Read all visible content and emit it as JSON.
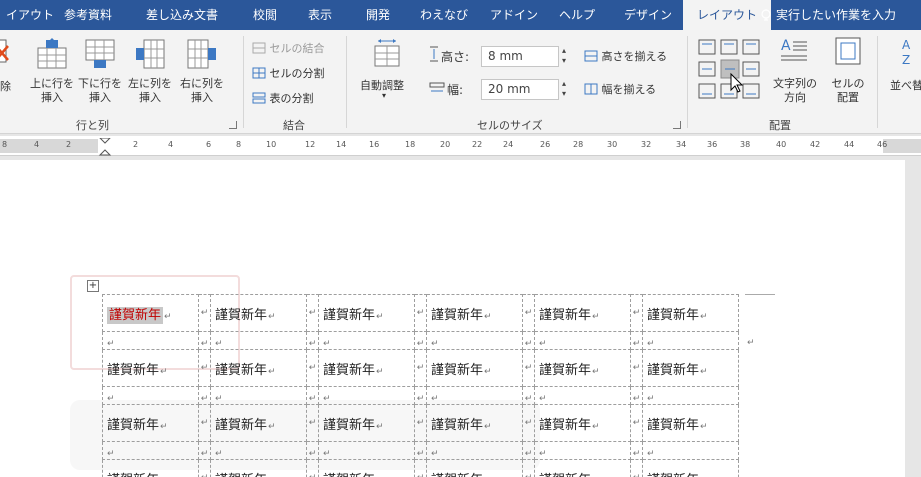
{
  "tabs": [
    {
      "label": "イアウト",
      "active": false
    },
    {
      "label": "参考資料",
      "active": false
    },
    {
      "label": "差し込み文書",
      "active": false
    },
    {
      "label": "校閲",
      "active": false
    },
    {
      "label": "表示",
      "active": false
    },
    {
      "label": "開発",
      "active": false
    },
    {
      "label": "わえなび",
      "active": false
    },
    {
      "label": "アドイン",
      "active": false
    },
    {
      "label": "ヘルプ",
      "active": false
    },
    {
      "label": "デザイン",
      "active": false
    },
    {
      "label": "レイアウト",
      "active": true
    }
  ],
  "tell_me": "実行したい作業を入力",
  "rows_cols": {
    "delete_label": "除",
    "insert_above": [
      "上に行を",
      "挿入"
    ],
    "insert_below": [
      "下に行を",
      "挿入"
    ],
    "insert_left": [
      "左に列を",
      "挿入"
    ],
    "insert_right": [
      "右に列を",
      "挿入"
    ],
    "group_label": "行と列"
  },
  "merge": {
    "merge_cells": "セルの結合",
    "split_cells": "セルの分割",
    "split_table": "表の分割",
    "group_label": "結合"
  },
  "cell_size": {
    "autofit": "自動調整",
    "height_label": "高さ:",
    "height_value": "8 mm",
    "width_label": "幅:",
    "width_value": "20 mm",
    "distribute_rows": "高さを揃える",
    "distribute_cols": "幅を揃える",
    "group_label": "セルのサイズ"
  },
  "alignment": {
    "text_direction": [
      "文字列の",
      "方向"
    ],
    "cell_margins": [
      "セルの",
      "配置"
    ],
    "group_label": "配置"
  },
  "sort_label": "並べ替",
  "ruler_numbers": [
    "8",
    "4",
    "2",
    "2",
    "4",
    "6",
    "8",
    "10",
    "12",
    "14",
    "16",
    "18",
    "20",
    "22",
    "24",
    "26",
    "28",
    "30",
    "32",
    "34",
    "36",
    "38",
    "40",
    "42",
    "44",
    "46"
  ],
  "table": {
    "cell_text": "謹賀新年",
    "para_mark": "↵",
    "rows": 4,
    "cols": 6
  },
  "colors": {
    "ribbon_blue": "#2b579a",
    "selected_text": "#c00000"
  }
}
